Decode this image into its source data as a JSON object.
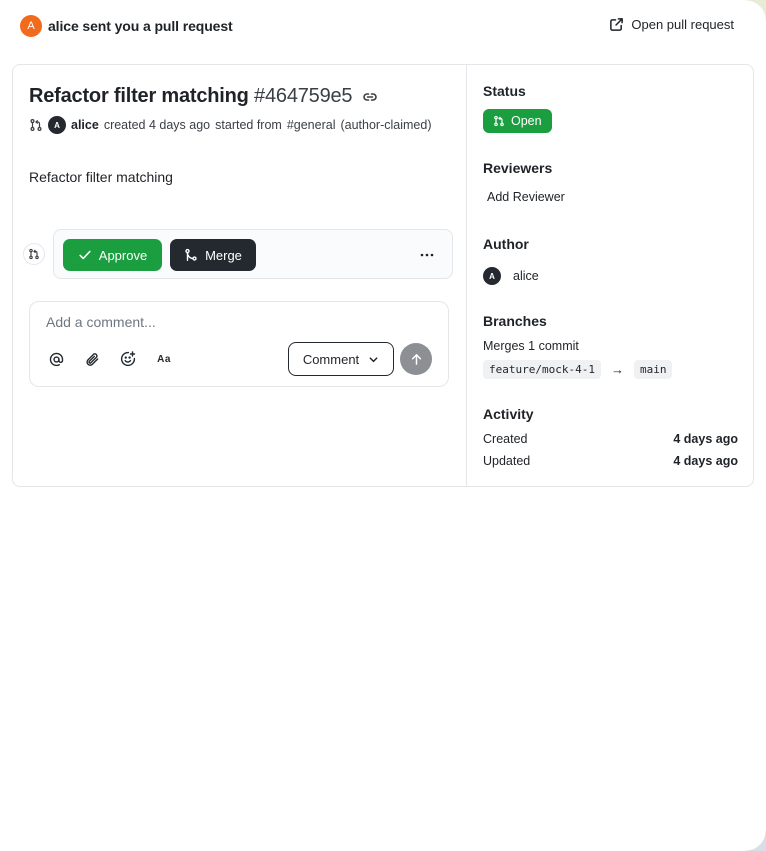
{
  "notification": {
    "avatar_initial": "A",
    "text": "alice sent you a pull request",
    "open_link_label": "Open pull request",
    "open_icon": "external-link-icon"
  },
  "pull_request": {
    "title": "Refactor filter matching",
    "number": "#464759e5",
    "link_icon": "link-icon",
    "meta": {
      "avatar_initial": "A",
      "author": "alice",
      "created_text": "created 4 days ago",
      "started_text": "started from",
      "channel": "#general",
      "claim": "(author-claimed)"
    },
    "description": "Refactor filter matching"
  },
  "actions": {
    "approve_label": "Approve",
    "merge_label": "Merge",
    "more_icon": "more-horizontal-icon"
  },
  "comment": {
    "placeholder": "Add a comment...",
    "mention_icon": "at-sign-icon",
    "attach_icon": "paperclip-icon",
    "emoji_icon": "emoji-add-icon",
    "format_label": "Aa",
    "submit_label": "Comment",
    "send_icon": "arrow-up-icon"
  },
  "sidebar": {
    "status": {
      "heading": "Status",
      "value": "Open"
    },
    "reviewers": {
      "heading": "Reviewers",
      "add_label": "Add Reviewer"
    },
    "author": {
      "heading": "Author",
      "avatar_initial": "A",
      "name": "alice"
    },
    "branches": {
      "heading": "Branches",
      "summary": "Merges 1 commit",
      "source": "feature/mock-4-1",
      "arrow": "→",
      "target": "main"
    },
    "activity": {
      "heading": "Activity",
      "rows": [
        {
          "label": "Created",
          "value": "4 days ago"
        },
        {
          "label": "Updated",
          "value": "4 days ago"
        }
      ]
    }
  },
  "colors": {
    "accent_green": "#1a9e3f",
    "dark_button": "#24292f",
    "avatar_orange": "#f26b1d",
    "border": "#e4e6ea"
  }
}
